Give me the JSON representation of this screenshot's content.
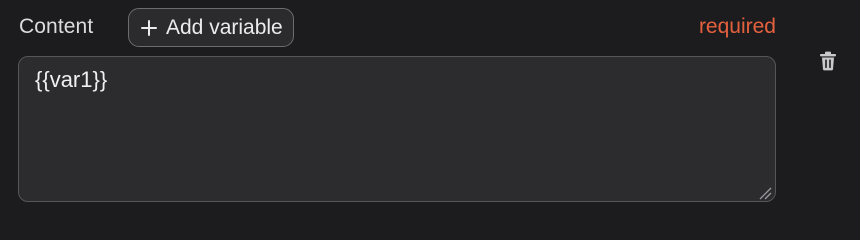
{
  "field": {
    "label": "Content",
    "add_variable_label": "Add variable",
    "required_text": "required",
    "value": "{{var1}}"
  },
  "icons": {
    "add": "plus-icon",
    "delete": "trash-icon",
    "resize": "resize-handle-icon"
  },
  "colors": {
    "background": "#1c1c1e",
    "required": "#e5613e",
    "input_bg": "#2c2c2f"
  }
}
